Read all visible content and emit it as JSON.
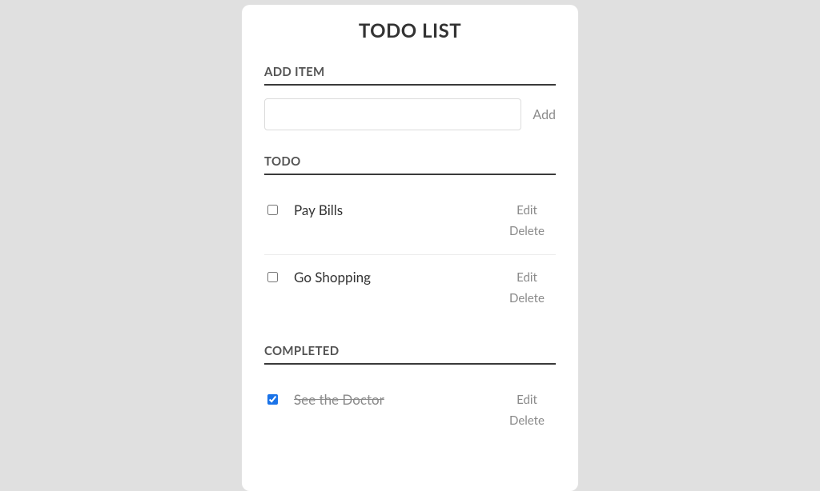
{
  "title": "TODO LIST",
  "addSection": {
    "header": "ADD ITEM",
    "inputValue": "",
    "addLabel": "Add"
  },
  "todoSection": {
    "header": "TODO",
    "items": [
      {
        "label": "Pay Bills",
        "checked": false,
        "editLabel": "Edit",
        "deleteLabel": "Delete"
      },
      {
        "label": "Go Shopping",
        "checked": false,
        "editLabel": "Edit",
        "deleteLabel": "Delete"
      }
    ]
  },
  "completedSection": {
    "header": "COMPLETED",
    "items": [
      {
        "label": "See the Doctor",
        "checked": true,
        "editLabel": "Edit",
        "deleteLabel": "Delete"
      }
    ]
  }
}
